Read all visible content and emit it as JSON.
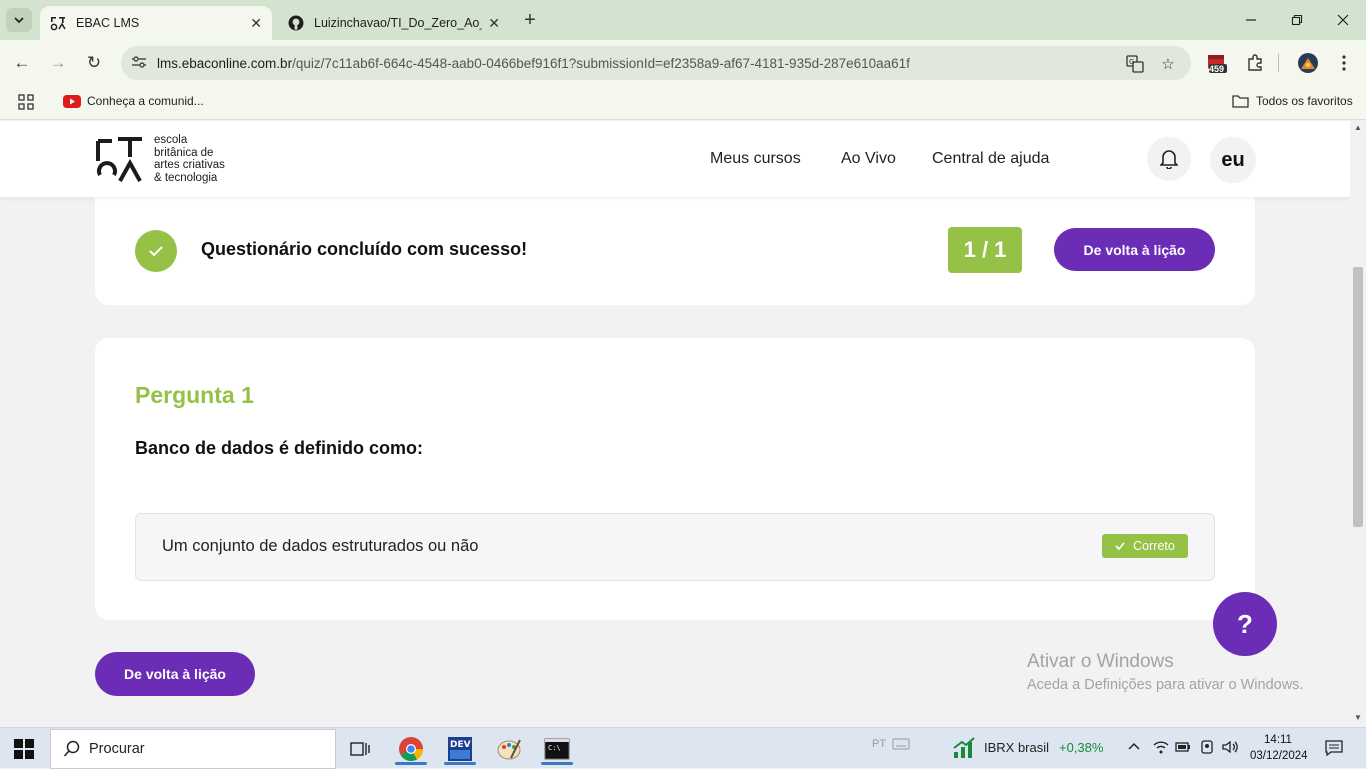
{
  "browser": {
    "tabs": [
      {
        "title": "EBAC LMS",
        "favicon": "ebac-logo-icon",
        "active": true
      },
      {
        "title": "Luizinchavao/TI_Do_Zero_Ao_Pr",
        "favicon": "github-icon",
        "active": false
      }
    ],
    "url_host": "lms.ebaconline.com.br",
    "url_path": "/quiz/7c11ab6f-664c-4548-aab0-0466bef916f1?submissionId=ef2358a9-af67-4181-935d-287e610aa61f",
    "extension_badge": "459",
    "bookmarks": {
      "item1": "Conheça a comunid...",
      "all_bookmarks": "Todos os favoritos"
    }
  },
  "site_header": {
    "logo_lines": [
      "escola",
      "britânica de",
      "artes criativas",
      "& tecnologia"
    ],
    "nav": [
      "Meus cursos",
      "Ao Vivo",
      "Central de ajuda"
    ],
    "avatar_text": "eu"
  },
  "result": {
    "title": "Questionário concluído com sucesso!",
    "score": "1 / 1",
    "back_label": "De volta à lição"
  },
  "question": {
    "label": "Pergunta 1",
    "text": "Banco de dados é definido como:",
    "answer": "Um conjunto de dados estruturados ou não",
    "badge": "Correto"
  },
  "bottom_button": "De volta à lição",
  "help_label": "?",
  "watermark": {
    "title": "Ativar o Windows",
    "subtitle": "Aceda a Definições para ativar o Windows."
  },
  "taskbar": {
    "search_placeholder": "Procurar",
    "language": "PT",
    "stock_name": "IBRX brasil",
    "stock_change": "+0,38%",
    "time": "14:11",
    "date": "03/12/2024"
  },
  "colors": {
    "accent_green": "#94c146",
    "accent_purple": "#6b2cb6",
    "stock_positive": "#1a8a3a"
  }
}
